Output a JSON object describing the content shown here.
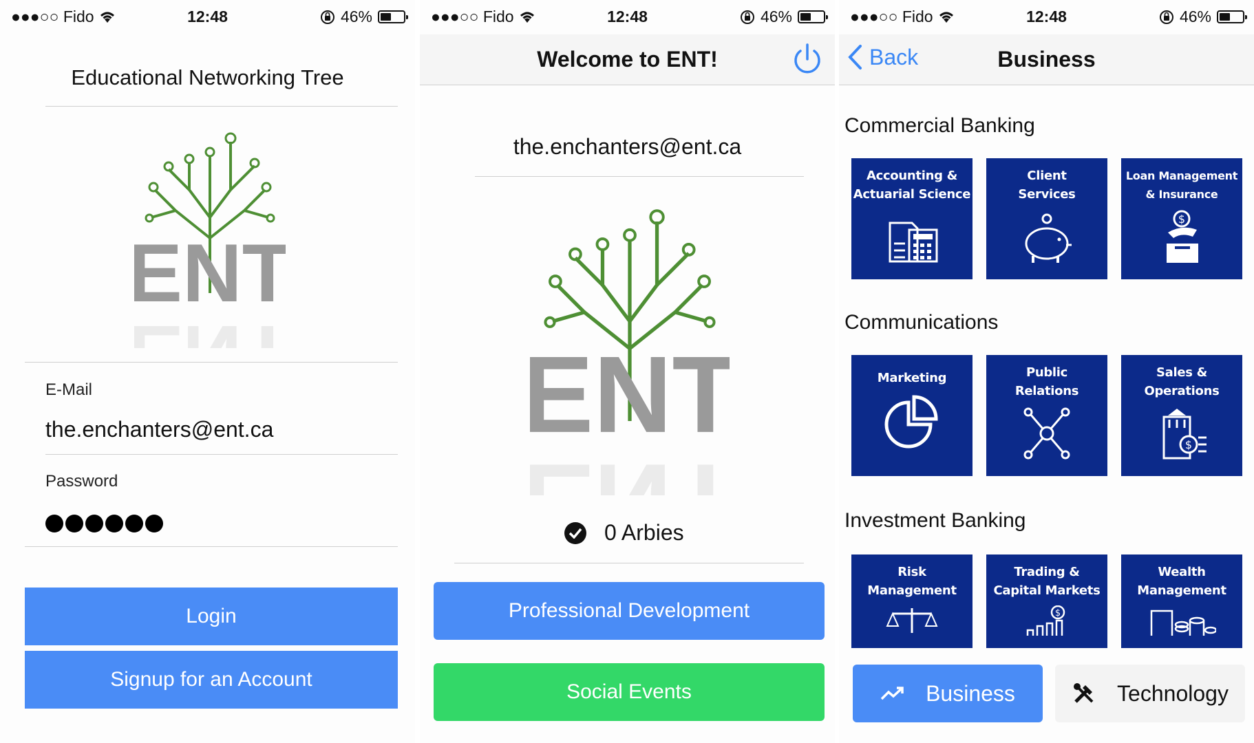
{
  "statusbar": {
    "carrier": "●●●○○ Fido",
    "time": "12:48",
    "battery": "46%",
    "battery_level": 0.46
  },
  "login": {
    "app_title": "Educational Networking Tree",
    "logo_text": "ENT",
    "email_label": "E-Mail",
    "email_value": "the.enchanters@ent.ca",
    "password_label": "Password",
    "password_mask_count": 6,
    "login_button": "Login",
    "signup_button": "Signup for an Account"
  },
  "home": {
    "nav_title": "Welcome to ENT!",
    "power_icon": "power-icon",
    "email": "the.enchanters@ent.ca",
    "logo_text": "ENT",
    "arbies": "0 Arbies",
    "prof_dev_button": "Professional Development",
    "social_button": "Social Events",
    "colors": {
      "blue": "#4a8cf6",
      "green": "#33d868"
    }
  },
  "business": {
    "back_label": "Back",
    "nav_title": "Business",
    "tile_color": "#0c2a8a",
    "sections": [
      {
        "title": "Commercial Banking",
        "tiles": [
          {
            "label": "Accounting &\nActuarial Science",
            "icon": "calculator-document-icon"
          },
          {
            "label": "Client\nServices",
            "icon": "piggy-bank-icon"
          },
          {
            "label": "Loan Management\n& Insurance",
            "icon": "coin-box-icon"
          }
        ]
      },
      {
        "title": "Communications",
        "tiles": [
          {
            "label": "Marketing",
            "icon": "pie-chart-icon"
          },
          {
            "label": "Public\nRelations",
            "icon": "network-icon"
          },
          {
            "label": "Sales &\nOperations",
            "icon": "bank-dollar-icon"
          }
        ]
      },
      {
        "title": "Investment Banking",
        "tiles": [
          {
            "label": "Risk\nManagement",
            "icon": "scales-icon"
          },
          {
            "label": "Trading &\nCapital Markets",
            "icon": "bar-chart-dollar-icon"
          },
          {
            "label": "Wealth\nManagement",
            "icon": "coins-icon"
          }
        ]
      }
    ],
    "tabs": [
      {
        "label": "Business",
        "icon": "trending-up-icon",
        "active": true
      },
      {
        "label": "Technology",
        "icon": "tools-icon",
        "active": false
      }
    ]
  }
}
